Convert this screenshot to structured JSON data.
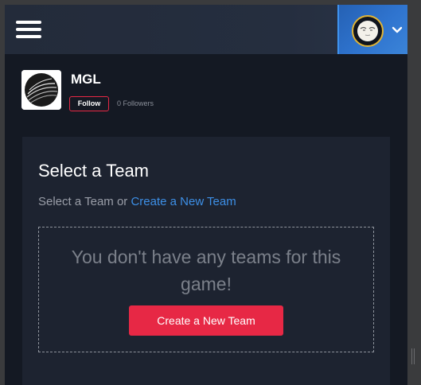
{
  "header": {
    "menu_icon": "hamburger-icon",
    "avatar_icon": "moon-face-avatar",
    "dropdown_icon": "chevron-down-icon",
    "accent": "#2f74cf"
  },
  "org": {
    "name": "MGL",
    "follow_label": "Follow",
    "followers": "0 Followers",
    "logo_icon": "mgl-sphere-logo"
  },
  "teams": {
    "title": "Select a Team",
    "subtitle_prefix": "Select a Team or ",
    "create_link": "Create a New Team",
    "empty_message": "You don't have any teams for this game!",
    "create_button": "Create a New Team",
    "button_color": "#e72845"
  }
}
